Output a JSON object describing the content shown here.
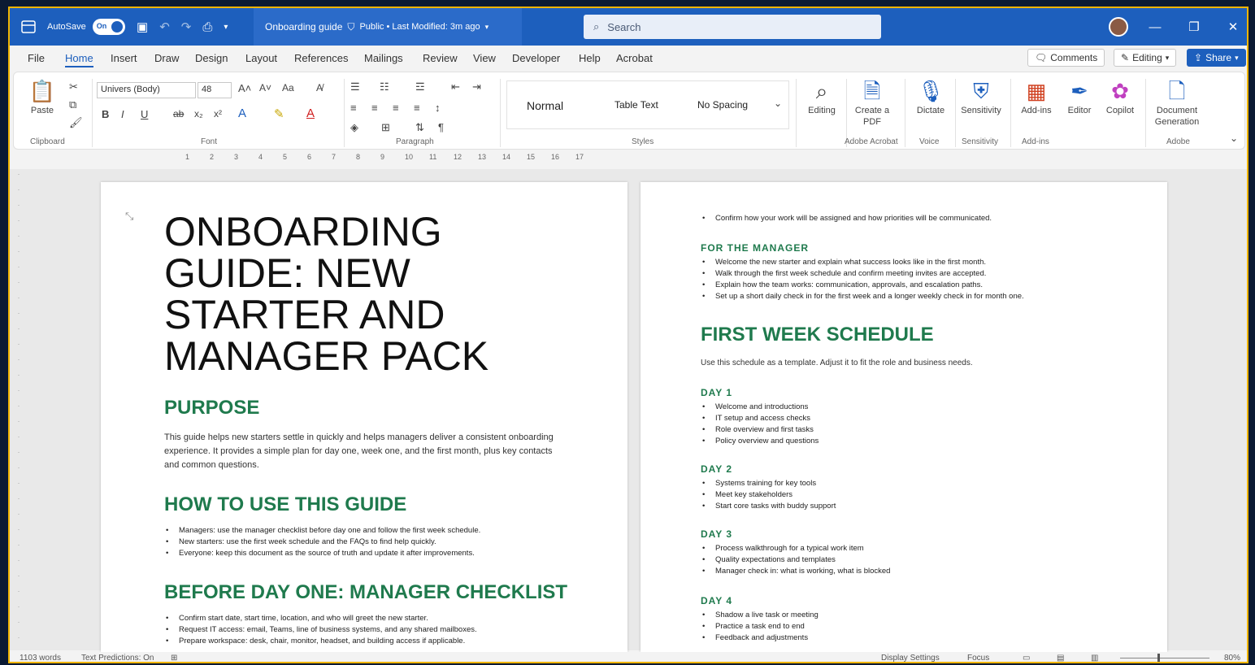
{
  "titlebar": {
    "autosave_label": "AutoSave",
    "autosave_state": "On",
    "doc_name": "Onboarding guide",
    "doc_meta": "Public • Last Modified: 3m ago",
    "search_placeholder": "Search"
  },
  "menu": [
    "File",
    "Home",
    "Insert",
    "Draw",
    "Design",
    "Layout",
    "References",
    "Mailings",
    "Review",
    "View",
    "Developer",
    "Help",
    "Acrobat"
  ],
  "menu_active": "Home",
  "actions": {
    "comments": "Comments",
    "editing": "Editing",
    "share": "Share"
  },
  "ribbon": {
    "clipboard": {
      "paste": "Paste",
      "group": "Clipboard"
    },
    "font": {
      "family": "Univers (Body)",
      "size": "48",
      "group": "Font"
    },
    "paragraph_group": "Paragraph",
    "styles": {
      "normal": "Normal",
      "table_text": "Table Text",
      "no_spacing": "No Spacing",
      "group": "Styles"
    },
    "editing": "Editing",
    "create_pdf": "Create a PDF",
    "create_pdf_group": "Adobe Acrobat",
    "voice": {
      "label": "Dictate",
      "group": "Voice"
    },
    "sensitivity": {
      "label": "Sensitivity",
      "group": "Sensitivity"
    },
    "addins": {
      "label": "Add-ins",
      "group": "Add-ins"
    },
    "editor": "Editor",
    "copilot": "Copilot",
    "docgen": {
      "label": "Document Generation",
      "group": "Adobe"
    }
  },
  "ruler_marks": [
    "1",
    "2",
    "3",
    "4",
    "5",
    "6",
    "7",
    "8",
    "9",
    "10",
    "11",
    "12",
    "13",
    "14",
    "15",
    "16",
    "17"
  ],
  "page1": {
    "title": "ONBOARDING GUIDE: NEW STARTER AND MANAGER PACK",
    "purpose_heading": "PURPOSE",
    "purpose_text": "This guide helps new starters settle in quickly and helps managers deliver a consistent onboarding experience. It provides a simple plan for day one, week one, and the first month, plus key contacts and common questions.",
    "howto_heading": "HOW TO USE THIS GUIDE",
    "howto_items": [
      "Managers: use the manager checklist before day one and follow the first week schedule.",
      "New starters: use the first week schedule and the FAQs to find help quickly.",
      "Everyone: keep this document as the source of truth and update it after improvements."
    ],
    "checklist_heading": "BEFORE DAY ONE: MANAGER CHECKLIST",
    "checklist_items": [
      "Confirm start date, start time, location, and who will greet the new starter.",
      "Request IT access: email, Teams, line of business systems, and any shared mailboxes.",
      "Prepare workspace: desk, chair, monitor, headset, and building access if applicable."
    ]
  },
  "page2": {
    "top_items": [
      "Confirm how your work will be assigned and how priorities will be communicated."
    ],
    "manager_heading": "FOR THE MANAGER",
    "manager_items": [
      "Welcome the new starter and explain what success looks like in the first month.",
      "Walk through the first week schedule and confirm meeting invites are accepted.",
      "Explain how the team works: communication, approvals, and escalation paths.",
      "Set up a short daily check in for the first week and a longer weekly check in for month one."
    ],
    "schedule_heading": "FIRST WEEK SCHEDULE",
    "schedule_intro": "Use this schedule as a template. Adjust it to fit the role and business needs.",
    "days": [
      {
        "label": "DAY 1",
        "items": [
          "Welcome and introductions",
          "IT setup and access checks",
          "Role overview and first tasks",
          "Policy overview and questions"
        ]
      },
      {
        "label": "DAY 2",
        "items": [
          "Systems training for key tools",
          "Meet key stakeholders",
          "Start core tasks with buddy support"
        ]
      },
      {
        "label": "DAY 3",
        "items": [
          "Process walkthrough for a typical work item",
          "Quality expectations and templates",
          "Manager check in: what is working, what is blocked"
        ]
      },
      {
        "label": "DAY 4",
        "items": [
          "Shadow a live task or meeting",
          "Practice a task end to end",
          "Feedback and adjustments"
        ]
      }
    ]
  },
  "status": {
    "words": "1103 words",
    "accessibility": "Text Predictions: On",
    "display_settings": "Display Settings",
    "focus": "Focus",
    "zoom": "80%"
  }
}
